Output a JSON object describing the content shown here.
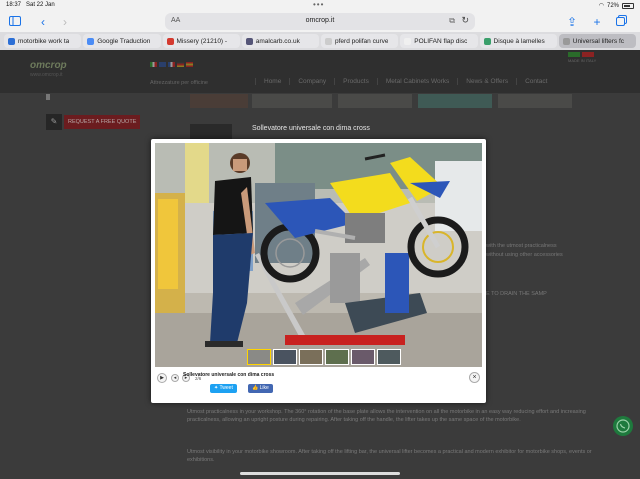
{
  "status": {
    "time": "18:37",
    "date": "Sat 22 Jan",
    "battery": "72%",
    "battery_level": 0.72
  },
  "browser": {
    "url": "omcrop.it",
    "aa": "AA",
    "tabs": [
      {
        "label": "motorbike work ta",
        "color": "#2c6fd6"
      },
      {
        "label": "Google Traduction",
        "color": "#4b8cf5"
      },
      {
        "label": "Missery (21210) -",
        "color": "#d43a2f"
      },
      {
        "label": "amalcarb.co.uk",
        "color": "#555577"
      },
      {
        "label": "pferd polifan curve",
        "color": "#cccccc"
      },
      {
        "label": "POLIFAN flap disc",
        "color": "#f0f0f0"
      },
      {
        "label": "Disque à lamelles",
        "color": "#3a9f6b"
      },
      {
        "label": "Universal lifters fc",
        "color": "#999999"
      }
    ]
  },
  "site": {
    "logo": "omcrop",
    "logo_sub": "www.omcrop.it",
    "subtitle": "Attrezzature per officine",
    "made_in_italy": "MADE IN ITALY",
    "nav": [
      "Home",
      "Company",
      "Products",
      "Metal Cabinets Works",
      "News & Offers",
      "Contact"
    ],
    "request_quote": "REQUEST A FREE QUOTE",
    "product_title": "Sollevatore universale con dima cross",
    "side_text_1": "with the utmost practicalness",
    "side_text_2": "without using other accessories",
    "side_text_3": "E TO DRAIN THE SAMP",
    "bottom_text_1": "Utmost practicalness in your workshop. The 360° rotation of the base plate allows the intervention on all the motorbike in an easy way reducing effort and increasing practicalness, allowing an upright posture during repairing. After taking off the handle, the lifter takes up the same space of the motorbike.",
    "bottom_text_2": "Utmost visibility in your motorbike showroom. After taking off the lifting bar, the universal lifter becomes a practical and modern exhibitor for motorbike shops, events or exhibitions."
  },
  "lightbox": {
    "caption": "Sollevatore universale con dima cross",
    "counter": "2/6",
    "tweet": "Tweet",
    "like": "Like",
    "close": "×",
    "thumbs": 6,
    "selected_thumb": 0
  },
  "colors": {
    "tweet": "#1da1f2",
    "like": "#4267b2",
    "bike_yellow": "#f3dc1d",
    "bike_blue": "#2c56b8",
    "lifter_red": "#c8211f"
  }
}
